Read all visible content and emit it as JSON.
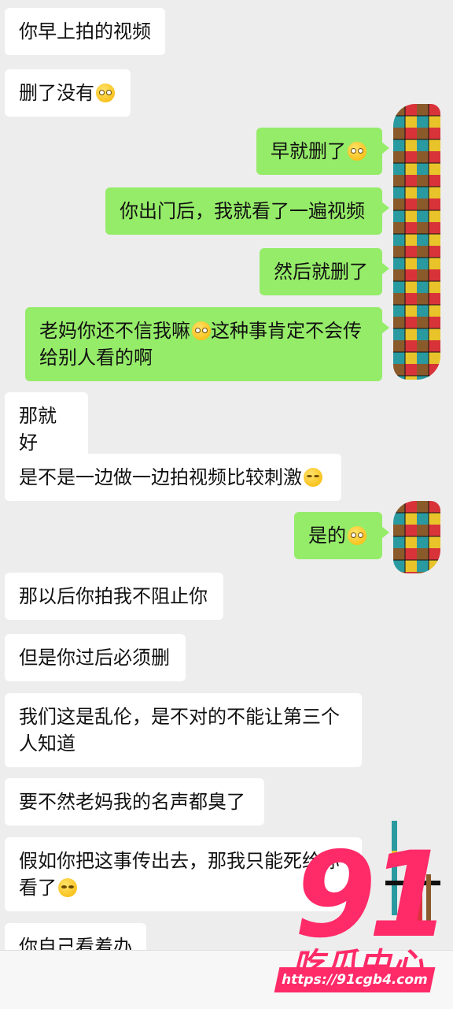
{
  "messages": [
    {
      "side": "left",
      "text": "你早上拍的视频",
      "emoji": null
    },
    {
      "side": "left",
      "text": "删了没有",
      "emoji": "flushed"
    },
    {
      "side": "right",
      "text": "早就删了",
      "emoji": "flushed"
    },
    {
      "side": "right",
      "text": "你出门后，我就看了一遍视频",
      "emoji": null
    },
    {
      "side": "right",
      "text": "然后就删了",
      "emoji": null
    },
    {
      "side": "right",
      "text": "老妈你还不信我嘛",
      "emoji": "relieved",
      "text2": "这种事肯定不会传给别人看的啊"
    },
    {
      "side": "left",
      "text": "那就好",
      "emoji": null
    },
    {
      "side": "left",
      "text": "是不是一边做一边拍视频比较刺激",
      "emoji": "laugh"
    },
    {
      "side": "right",
      "text": "是的",
      "emoji": "flushed"
    },
    {
      "side": "left",
      "text": "那以后你拍我不阻止你",
      "emoji": null
    },
    {
      "side": "left",
      "text": "但是你过后必须删",
      "emoji": null
    },
    {
      "side": "left",
      "text": "我们这是乱伦，是不对的不能让第三个人知道",
      "emoji": null
    },
    {
      "side": "left",
      "text": "要不然老妈我的名声都臭了",
      "emoji": null
    },
    {
      "side": "left",
      "text": "假如你把这事传出去，那我只能死给你看了",
      "emoji": "smile"
    },
    {
      "side": "left",
      "text": "你自己看着办",
      "emoji": null
    }
  ],
  "watermark": {
    "logo": "91",
    "brand": "吃瓜中心",
    "url": "https://91cgb4.com",
    "color": "#ff2a68"
  },
  "colors": {
    "background": "#ededed",
    "sent_bubble": "#95ec69",
    "received_bubble": "#ffffff"
  }
}
